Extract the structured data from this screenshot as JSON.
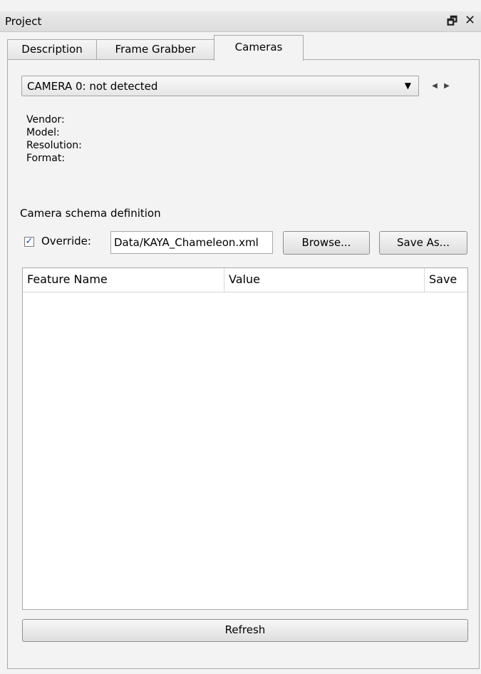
{
  "window": {
    "title": "Project",
    "restore_glyph": "🗗",
    "close_glyph": "✕"
  },
  "tabs": [
    {
      "label": "Description",
      "active": false
    },
    {
      "label": "Frame Grabber",
      "active": false
    },
    {
      "label": "Cameras",
      "active": true
    }
  ],
  "camera_select": {
    "selected": "CAMERA 0: not detected",
    "arrow": "▼",
    "spin_left": "◀",
    "spin_right": "▶"
  },
  "info": {
    "vendor_label": "Vendor:",
    "model_label": "Model:",
    "resolution_label": "Resolution:",
    "format_label": "Format:"
  },
  "schema": {
    "section_label": "Camera schema definition",
    "override_checked": true,
    "check_glyph": "✓",
    "override_label": "Override:",
    "path_value": "Data/KAYA_Chameleon.xml",
    "browse_label": "Browse...",
    "save_as_label": "Save As..."
  },
  "features_table": {
    "columns": [
      "Feature Name",
      "Value",
      "Save"
    ],
    "rows": []
  },
  "refresh_label": "Refresh"
}
